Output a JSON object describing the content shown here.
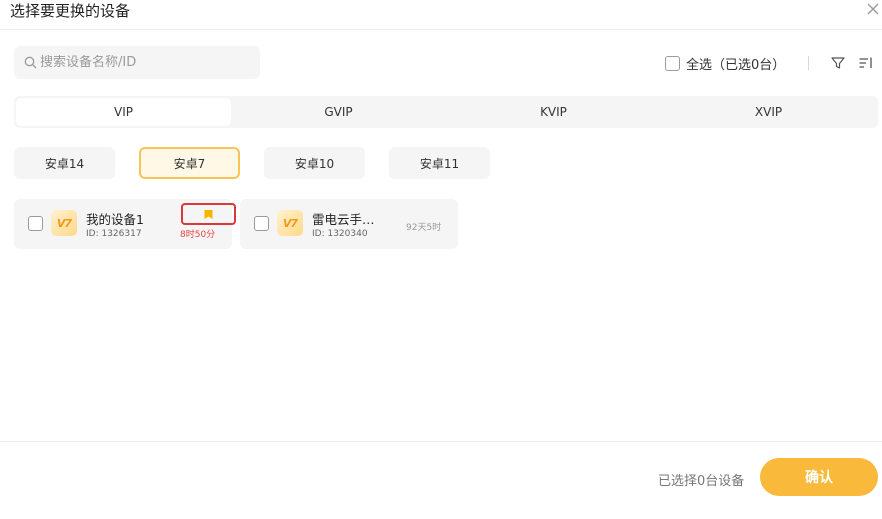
{
  "dialog": {
    "title": "选择要更换的设备"
  },
  "search": {
    "placeholder": "搜索设备名称/ID"
  },
  "select_all": {
    "label": "全选（已选0台）"
  },
  "tabs": [
    {
      "label": "VIP",
      "active": true
    },
    {
      "label": "GVIP",
      "active": false
    },
    {
      "label": "KVIP",
      "active": false
    },
    {
      "label": "XVIP",
      "active": false
    }
  ],
  "android_versions": [
    {
      "label": "安卓14",
      "active": false
    },
    {
      "label": "安卓7",
      "active": true
    },
    {
      "label": "安卓10",
      "active": false
    },
    {
      "label": "安卓11",
      "active": false
    }
  ],
  "devices": [
    {
      "logo": "V7",
      "name": "我的设备1",
      "id": "ID: 1326317",
      "remaining": "8时50分",
      "remaining_color": "#e2453c",
      "has_badge": true
    },
    {
      "logo": "V7",
      "name": "雷电云手…",
      "id": "ID: 1320340",
      "remaining": "92天5时",
      "remaining_color": "#999999",
      "has_badge": false
    }
  ],
  "footer": {
    "selected_text": "已选择0台设备",
    "confirm_label": "确认"
  },
  "colors": {
    "accent": "#f9b93a",
    "highlight_border": "#d9393b",
    "badge": "#f7b500"
  },
  "icons": {
    "close": "close-icon",
    "search": "search-icon",
    "filter": "filter-icon",
    "sort": "sort-icon",
    "badge": "bookmark-icon"
  }
}
